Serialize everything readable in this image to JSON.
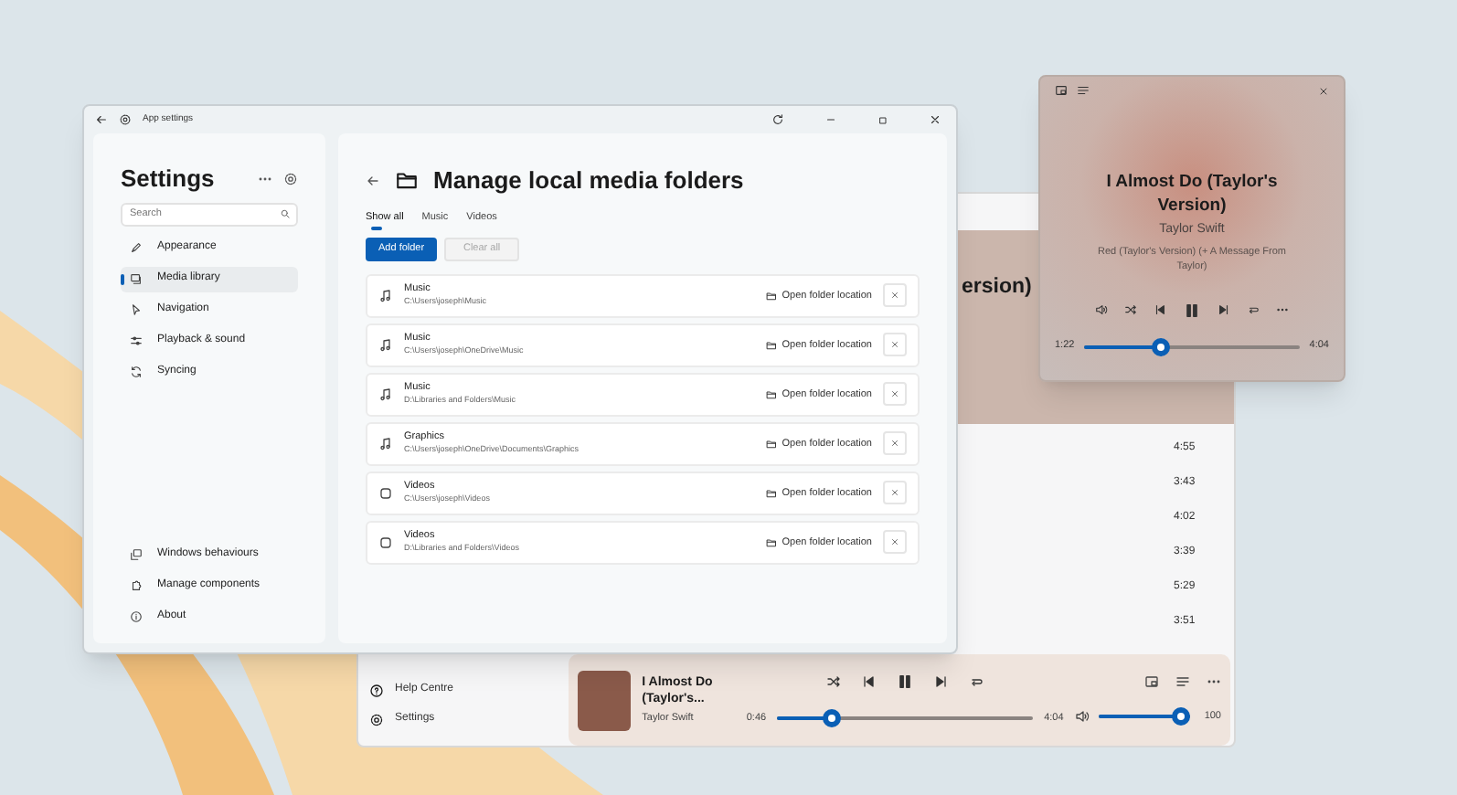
{
  "background_app": {
    "header_title": "ersion)",
    "durations": [
      "4:55",
      "3:43",
      "4:02",
      "3:39",
      "5:29",
      "3:51"
    ],
    "sidebar_items": [
      {
        "label": "Help Centre"
      },
      {
        "label": "Settings"
      }
    ],
    "now_playing_bar": {
      "title": "I Almost Do (Taylor's...",
      "artist": "Taylor Swift",
      "elapsed": "0:46",
      "total": "4:04",
      "progress": {
        "level": 0.19
      },
      "volume": {
        "level": 1
      },
      "volume_reading": "100"
    }
  },
  "settings_window": {
    "title": "App settings",
    "sidebar": {
      "title": "Settings",
      "search": {
        "placeholder": "Search"
      },
      "items": [
        {
          "label": "Appearance",
          "selected": false
        },
        {
          "label": "Media library",
          "selected": true
        },
        {
          "label": "Navigation",
          "selected": false
        },
        {
          "label": "Playback & sound",
          "selected": false
        },
        {
          "label": "Syncing",
          "selected": false
        }
      ],
      "footer_items": [
        {
          "label": "Windows behaviours"
        },
        {
          "label": "Manage components"
        },
        {
          "label": "About"
        }
      ]
    },
    "page": {
      "title": "Manage local media folders",
      "tabs": [
        {
          "label": "Show all",
          "selected": true
        },
        {
          "label": "Music",
          "selected": false
        },
        {
          "label": "Videos",
          "selected": false
        }
      ],
      "buttons": [
        {
          "label": "Add folder",
          "disabled": false
        },
        {
          "label": "Clear all",
          "disabled": true
        }
      ],
      "folders": [
        {
          "kind": "music",
          "name": "Music",
          "path": "C:\\Users\\joseph\\Music",
          "action": "Open folder location"
        },
        {
          "kind": "music",
          "name": "Music",
          "path": "C:\\Users\\joseph\\OneDrive\\Music",
          "action": "Open folder location"
        },
        {
          "kind": "music",
          "name": "Music",
          "path": "D:\\Libraries and Folders\\Music",
          "action": "Open folder location"
        },
        {
          "kind": "music",
          "name": "Graphics",
          "path": "C:\\Users\\joseph\\OneDrive\\Documents\\Graphics",
          "action": "Open folder location"
        },
        {
          "kind": "video",
          "name": "Videos",
          "path": "C:\\Users\\joseph\\Videos",
          "action": "Open folder location"
        },
        {
          "kind": "video",
          "name": "Videos",
          "path": "D:\\Libraries and Folders\\Videos",
          "action": "Open folder location"
        }
      ]
    }
  },
  "mini_player": {
    "title": "I Almost Do (Taylor's Version)",
    "artist": "Taylor Swift",
    "album": "Red (Taylor's Version) (+ A Message From Taylor)",
    "elapsed": "1:22",
    "total": "4:04",
    "progress": {
      "level": 0.34
    }
  }
}
